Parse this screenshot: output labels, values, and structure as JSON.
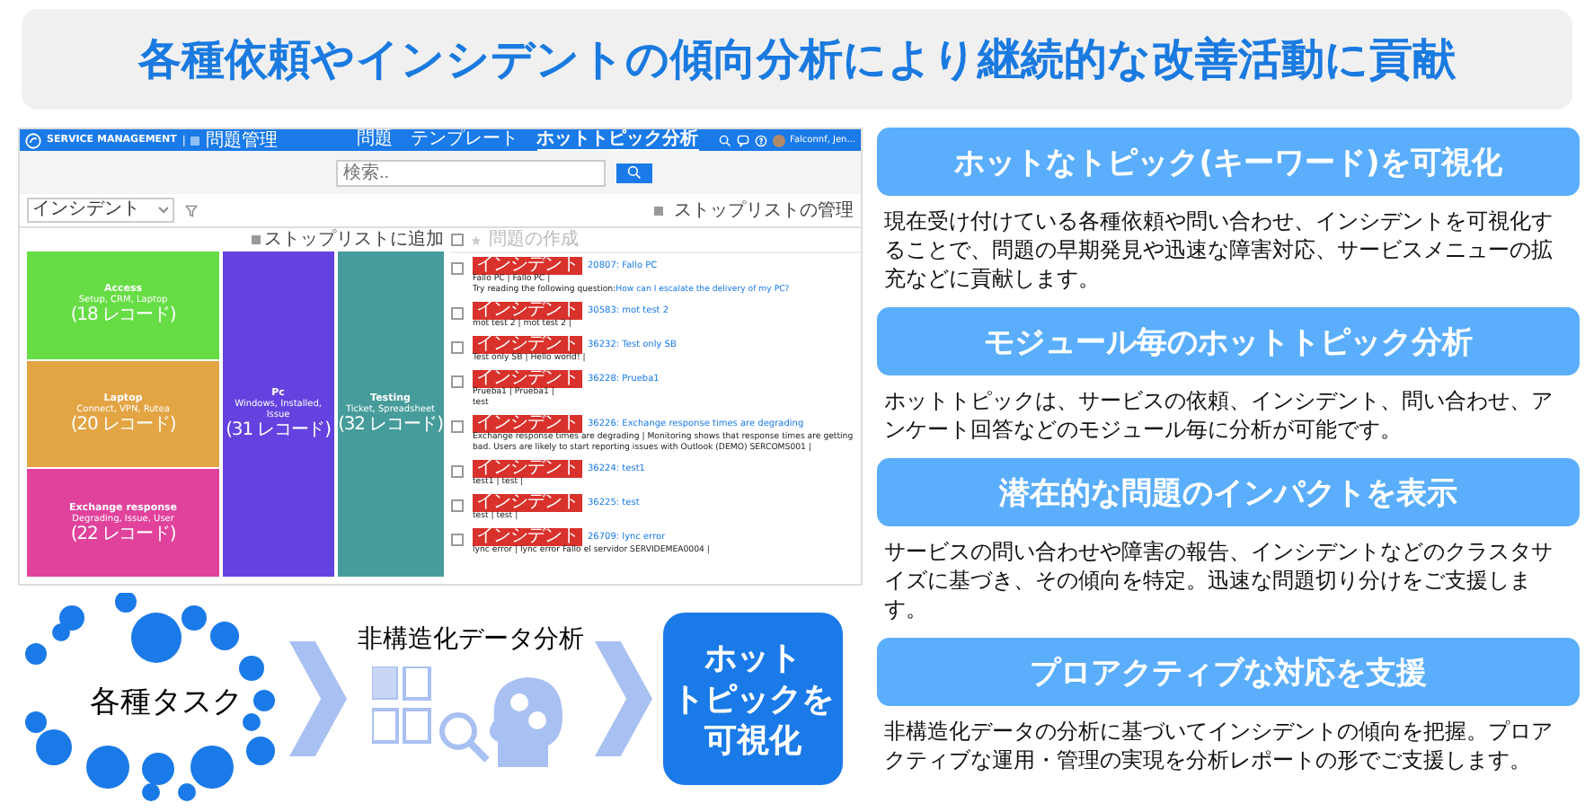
{
  "banner": {
    "title": "各種依頼やインシデントの傾向分析により継続的な改善活動に貢献"
  },
  "app": {
    "brand": "SERVICE MANAGEMENT",
    "separator": "|",
    "module": "問題管理",
    "nav": [
      {
        "label": "問題",
        "selected": false
      },
      {
        "label": "テンプレート",
        "selected": false
      },
      {
        "label": "ホットトピック分析",
        "selected": true
      }
    ],
    "user": "Falconnf, Jen...",
    "search": {
      "placeholder": "検索.."
    },
    "filter": {
      "value": "インシデント"
    },
    "stoplist_manage": "ストップリストの管理",
    "stoplist_add": "ストップリストに追加",
    "select_all": {
      "checked": false
    },
    "create_problem": {
      "label": "問題の作成",
      "disabled": true
    },
    "treemap": {
      "columns": [
        {
          "tiles": [
            {
              "title": "Access",
              "keywords": "Setup, CRM, Laptop",
              "count": "(18 レコード)",
              "color": "#66dd44"
            },
            {
              "title": "Laptop",
              "keywords": "Connect, VPN, Rutea",
              "count": "(20 レコード)",
              "color": "#e3a444"
            },
            {
              "title": "Exchange response",
              "keywords": "Degrading, Issue, User",
              "count": "(22 レコード)",
              "color": "#e0429c"
            }
          ]
        },
        {
          "tiles": [
            {
              "title": "Pc",
              "keywords": "Windows, Installed, Issue",
              "count": "(31 レコード)",
              "color": "#6442e0"
            }
          ]
        },
        {
          "tiles": [
            {
              "title": "Testing",
              "keywords": "Ticket, Spreadsheet",
              "count": "(32 レコード)",
              "color": "#459c9a"
            }
          ]
        }
      ]
    },
    "records": [
      {
        "badge": "インシデント",
        "title": "20807: Fallo PC",
        "lines": [
          "Fallo PC | Fallo PC |"
        ],
        "question": "Try reading the following question:",
        "link": "How can I escalate the delivery of my PC?",
        "checked": false
      },
      {
        "badge": "インシデント",
        "title": "30583: mot test 2",
        "lines": [
          "mot test 2 | mot test 2 |"
        ],
        "checked": false
      },
      {
        "badge": "インシデント",
        "title": "36232: Test only SB",
        "lines": [
          "Test only SB | Hello world! |"
        ],
        "checked": false
      },
      {
        "badge": "インシデント",
        "title": "36228: Prueba1",
        "lines": [
          "Prueba1 | Prueba1 |",
          "test"
        ],
        "checked": false
      },
      {
        "badge": "インシデント",
        "title": "36226: Exchange response times are degrading",
        "lines": [
          "Exchange response times are degrading | Monitoring shows that response times are getting bad. Users are likely to start reporting issues with Outlook (DEMO) SERCOMS001 |"
        ],
        "checked": false
      },
      {
        "badge": "インシデント",
        "title": "36224: test1",
        "lines": [
          "test1 | test |"
        ],
        "checked": false
      },
      {
        "badge": "インシデント",
        "title": "36225: test",
        "lines": [
          "test | test |"
        ],
        "checked": false
      },
      {
        "badge": "インシデント",
        "title": "26709: lync error",
        "lines": [
          "lync error | lync error Fallo el servidor SERVIDEMEA0004 |"
        ],
        "checked": false
      }
    ]
  },
  "flow": {
    "source": "各種タスク",
    "step": "非構造化データ分析",
    "result": [
      "ホット",
      "トピックを",
      "可視化"
    ]
  },
  "features": [
    {
      "heading": "ホットなトピック(キーワード)を可視化",
      "text": "現在受け付けている各種依頼や問い合わせ、インシデントを可視化することで、問題の早期発見や迅速な障害対応、サービスメニューの拡充などに貢献します。"
    },
    {
      "heading": "モジュール毎のホットトピック分析",
      "text": "ホットトピックは、サービスの依頼、インシデント、問い合わせ、アンケート回答などのモジュール毎に分析が可能です。"
    },
    {
      "heading": "潜在的な問題のインパクトを表示",
      "text": "サービスの問い合わせや障害の報告、インシデントなどのクラスタサイズに基づき、その傾向を特定。迅速な問題切り分けをご支援します。"
    },
    {
      "heading": "プロアクティブな対応を支援",
      "text": "非構造化データの分析に基づいてインシデントの傾向を把握。プロアクティブな運用・管理の実現を分析レポートの形でご支援します。"
    }
  ]
}
